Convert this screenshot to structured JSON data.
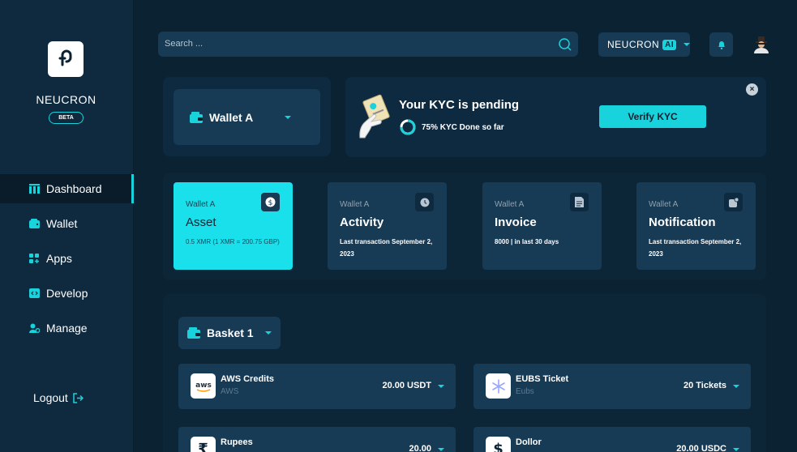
{
  "brand": {
    "name": "NEUCRON",
    "badge": "BETA"
  },
  "sidebar": {
    "items": [
      {
        "label": "Dashboard",
        "icon": "dashboard-icon",
        "active": true
      },
      {
        "label": "Wallet",
        "icon": "wallet-icon"
      },
      {
        "label": "Apps",
        "icon": "apps-icon"
      },
      {
        "label": "Develop",
        "icon": "code-icon"
      },
      {
        "label": "Manage",
        "icon": "manage-users-icon"
      }
    ],
    "logout": "Logout"
  },
  "topbar": {
    "search_placeholder": "Search ...",
    "product": "NEUCRON",
    "product_badge": "AI"
  },
  "wallet_selector": {
    "label": "Wallet A"
  },
  "kyc": {
    "title": "Your KYC is pending",
    "progress_text": "75% KYC Done so far",
    "progress": 0.75,
    "button": "Verify KYC",
    "close": "×"
  },
  "cards": [
    {
      "sub": "Wallet A",
      "title": "Asset",
      "desc": "0.5 XMR (1 XMR = 200.75 GBP)",
      "icon": "dollar-icon",
      "active": true
    },
    {
      "sub": "Wallet A",
      "title": "Activity",
      "desc": "Last transaction September 2, 2023",
      "icon": "clock-icon"
    },
    {
      "sub": "Wallet A",
      "title": "Invoice",
      "desc": "8000 | in last 30 days",
      "icon": "invoice-icon"
    },
    {
      "sub": "Wallet A",
      "title": "Notification",
      "desc": "Last transaction September 2, 2023",
      "icon": "notification-icon"
    }
  ],
  "basket": {
    "label": "Basket 1",
    "assets": [
      {
        "name": "AWS Credits",
        "sub": "AWS",
        "value": "20.00 USDT",
        "logo": "aws"
      },
      {
        "name": "EUBS Ticket",
        "sub": "Eubs",
        "value": "20 Tickets",
        "logo": "snowflake"
      },
      {
        "name": "Rupees",
        "sub": "",
        "value": "20.00",
        "logo": "₹"
      },
      {
        "name": "Dollor",
        "sub": "",
        "value": "20.00 USDC",
        "logo": "$"
      }
    ]
  },
  "colors": {
    "accent": "#19d3dc",
    "background": "#0b2233",
    "panel": "#173a55",
    "sidebar": "#0f2a3f"
  }
}
